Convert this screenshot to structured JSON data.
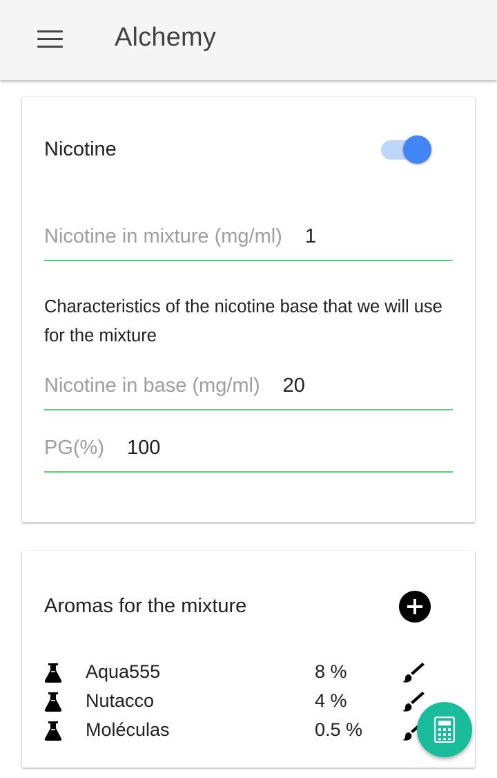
{
  "app": {
    "title": "Alchemy"
  },
  "nicotine": {
    "label": "Nicotine",
    "enabled": true,
    "mixture_field": {
      "placeholder": "Nicotine in mixture (mg/ml)",
      "value": "1"
    },
    "base_description": "Characteristics of the nicotine base that we will use for the mixture",
    "base_field": {
      "placeholder": "Nicotine in base (mg/ml)",
      "value": "20"
    },
    "pg_field": {
      "placeholder": "PG(%)",
      "value": "100"
    }
  },
  "aromas": {
    "title": "Aromas for the mixture",
    "items": [
      {
        "name": "Aqua555",
        "percent": "8 %"
      },
      {
        "name": "Nutacco",
        "percent": "4 %"
      },
      {
        "name": "Moléculas",
        "percent": "0.5 %"
      }
    ]
  },
  "icons": {
    "menu": "hamburger-menu-icon",
    "add": "plus-circle-icon",
    "flask": "flask-icon",
    "edit": "brush-icon",
    "calculator": "calculator-icon"
  },
  "colors": {
    "accent": "#4285f4",
    "field_underline": "#5ccb7c",
    "fab": "#1abc9c"
  }
}
